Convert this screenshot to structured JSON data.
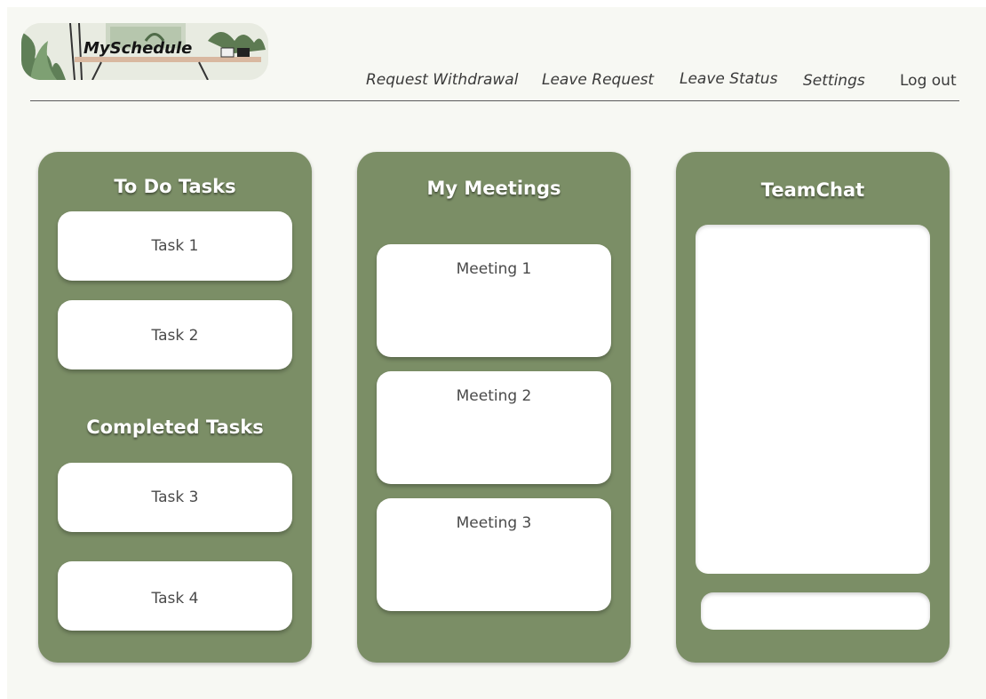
{
  "app": {
    "logo_text": "MySchedule"
  },
  "nav": {
    "items": [
      {
        "label": "Request Withdrawal"
      },
      {
        "label": "Leave Request"
      },
      {
        "label": "Leave Status"
      },
      {
        "label": "Settings"
      },
      {
        "label": "Log out"
      }
    ]
  },
  "todo": {
    "title": "To Do Tasks",
    "tasks": [
      "Task 1",
      "Task 2"
    ],
    "completed_title": "Completed Tasks",
    "completed": [
      "Task 3",
      "Task 4"
    ]
  },
  "meetings": {
    "title": "My Meetings",
    "items": [
      "Meeting 1",
      "Meeting 2",
      "Meeting 3"
    ]
  },
  "chat": {
    "title": "TeamChat"
  },
  "colors": {
    "panel": "#7b8e66",
    "background": "#f7f8f3"
  }
}
